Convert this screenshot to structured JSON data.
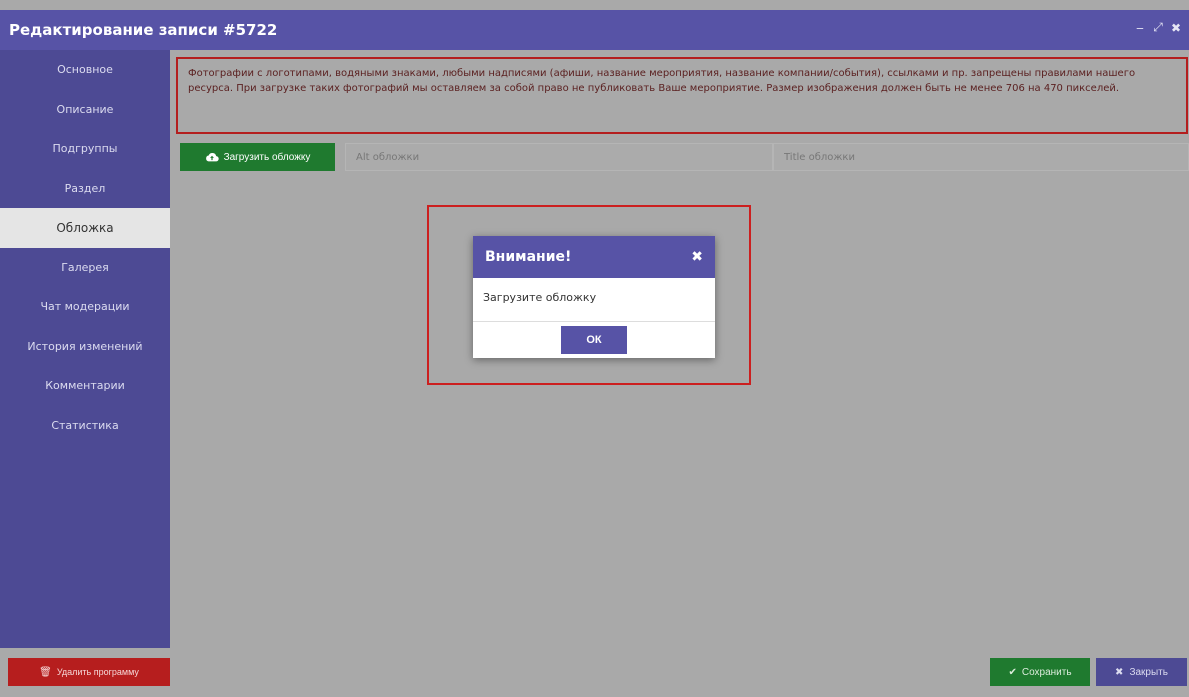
{
  "window": {
    "title": "Редактирование записи #5722",
    "controls": {
      "minimize": "‒",
      "maximize": "⤢",
      "close": "✖"
    }
  },
  "sidebar": {
    "items": [
      {
        "label": "Основное"
      },
      {
        "label": "Описание"
      },
      {
        "label": "Подгруппы"
      },
      {
        "label": "Раздел"
      },
      {
        "label": "Обложка",
        "active": true
      },
      {
        "label": "Галерея"
      },
      {
        "label": "Чат модерации"
      },
      {
        "label": "История изменений"
      },
      {
        "label": "Комментарии"
      },
      {
        "label": "Статистика"
      }
    ]
  },
  "notice": {
    "text": "Фотографии с логотипами, водяными знаками, любыми надписями (афиши, название мероприятия, название компании/события), ссылками и пр. запрещены правилами нашего ресурса. При загрузке таких фотографий мы оставляем за собой право не публиковать Ваше мероприятие. Размер изображения должен быть не менее 706 на 470 пикселей."
  },
  "toolbar": {
    "upload_label": "Загрузить обложку",
    "alt_placeholder": "Alt обложки",
    "title_placeholder": "Title обложки"
  },
  "modal": {
    "title": "Внимание!",
    "message": "Загрузите обложку",
    "ok_label": "ОК"
  },
  "footer": {
    "delete_label": "Удалить программу",
    "save_label": "Сохранить",
    "close_label": "Закрыть"
  },
  "colors": {
    "accent": "#5753a6",
    "sidebar": "#4d4a94",
    "success": "#1f7a2f",
    "danger": "#b61e1e",
    "highlight": "#cc1f1f"
  }
}
